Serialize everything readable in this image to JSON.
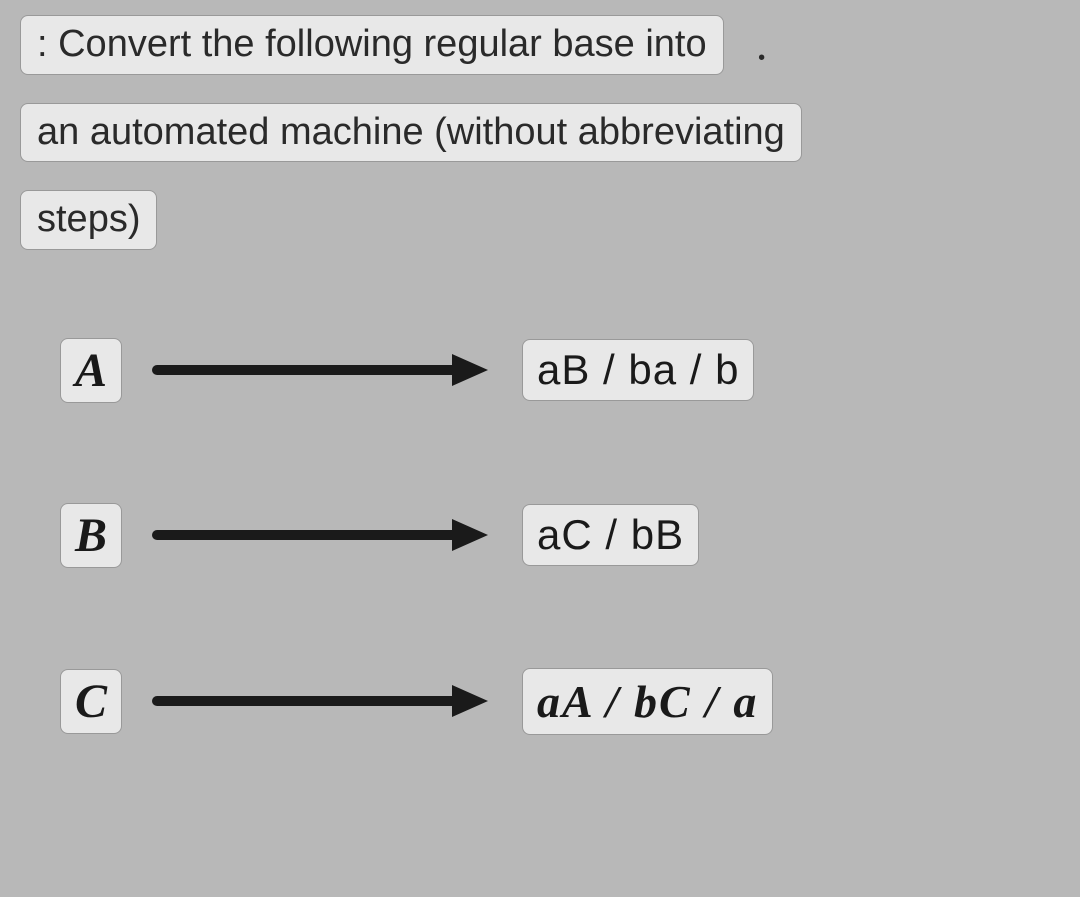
{
  "question": {
    "line1": ": Convert the following regular base into",
    "line2": "an automated machine (without abbreviating",
    "line3": "steps)"
  },
  "rules": [
    {
      "lhs": "A",
      "rhs": "aB / ba / b",
      "serif": false
    },
    {
      "lhs": "B",
      "rhs": "aC / bB",
      "serif": false
    },
    {
      "lhs": "C",
      "rhs": "aA / bC / a",
      "serif": true
    }
  ]
}
